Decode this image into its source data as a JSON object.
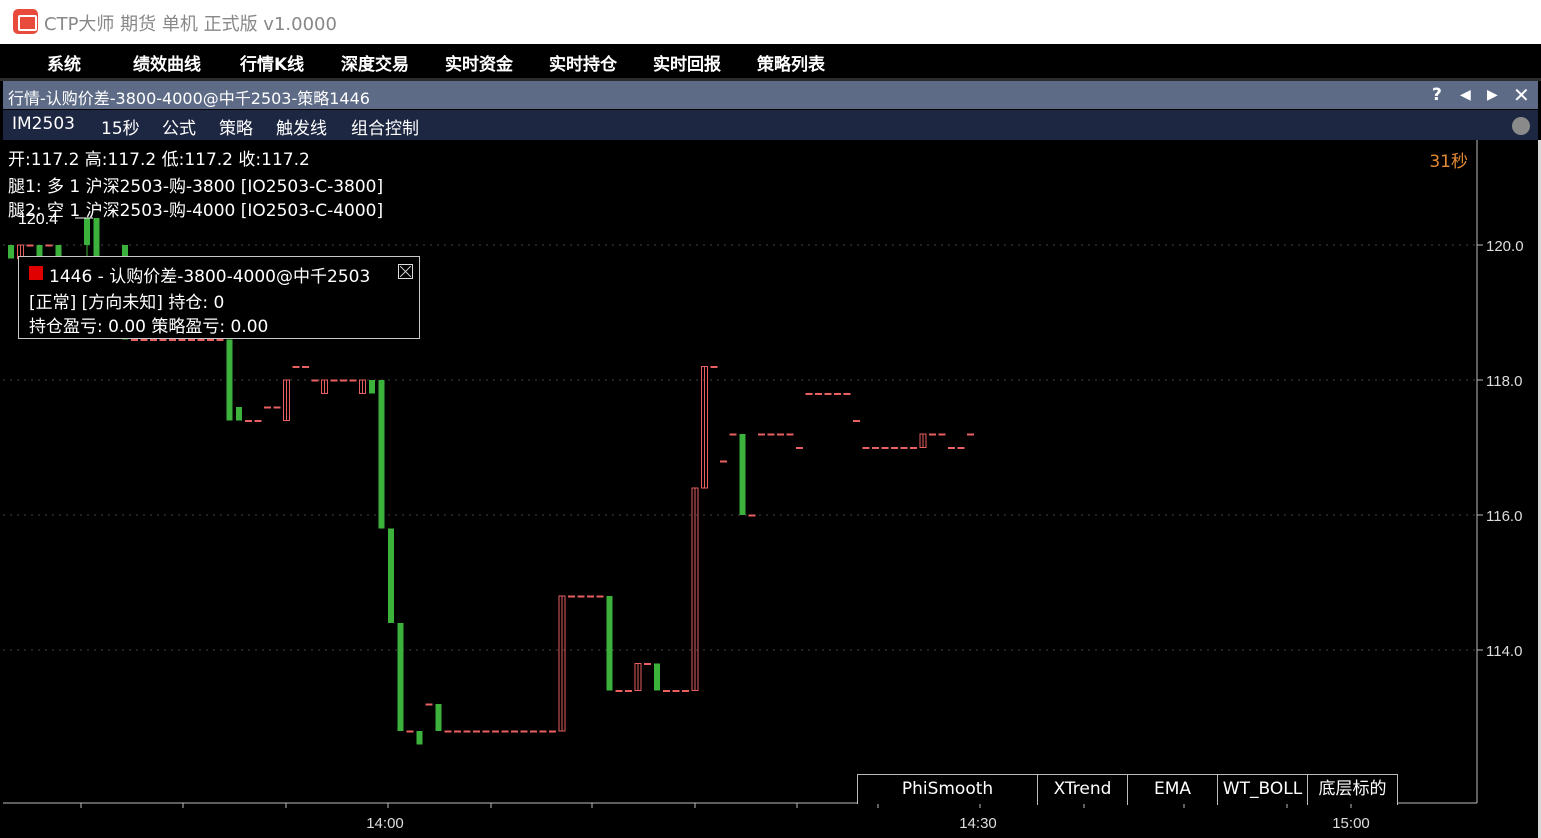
{
  "app": {
    "title": "CTP大师 期货 单机 正式版 v1.0000"
  },
  "menu": [
    "系统",
    "绩效曲线",
    "行情K线",
    "深度交易",
    "实时资金",
    "实时持仓",
    "实时回报",
    "策略列表"
  ],
  "window": {
    "title": "行情-认购价差-3800-4000@中千2503-策略1446",
    "buttons": [
      "?",
      "◀",
      "▶",
      "✕"
    ]
  },
  "toolbar": [
    "IM2503",
    "15秒",
    "公式",
    "策略",
    "触发线",
    "组合控制"
  ],
  "info": {
    "ohlc": "开:117.2 高:117.2 低:117.2 收:117.2",
    "leg1": "腿1: 多 1 沪深2503-购-3800 [IO2503-C-3800]",
    "leg2": "腿2: 空 1 沪深2503-购-4000 [IO2503-C-4000]",
    "timer": "31秒"
  },
  "popup": {
    "title": "1446 - 认购价差-3800-4000@中千2503",
    "line1": "[正常] [方向未知] 持仓: 0",
    "line2": "持仓盈亏: 0.00 策略盈亏: 0.00"
  },
  "indicators": [
    "PhiSmooth",
    "XTrend",
    "EMA",
    "WT_BOLL",
    "底层标的"
  ],
  "colors": {
    "up": "#e86060",
    "down": "#3cb23c",
    "accent": "#e38a34",
    "axis": "#bbbbbb"
  },
  "chart_data": {
    "type": "candlestick",
    "y_ticks": [
      120.0,
      118.0,
      116.0,
      114.0
    ],
    "x_ticks": [
      "14:00",
      "14:30",
      "15:00"
    ],
    "max_label": "120.4",
    "grid": true,
    "candles": [
      [
        120.0,
        120.0,
        119.8,
        119.8
      ],
      [
        119.8,
        120.0,
        119.8,
        120.0
      ],
      [
        120.0,
        120.0,
        120.0,
        120.0
      ],
      [
        120.0,
        120.0,
        119.8,
        119.8
      ],
      [
        120.0,
        120.0,
        120.0,
        120.0
      ],
      [
        120.0,
        120.0,
        119.6,
        119.6
      ],
      [
        119.6,
        119.6,
        119.6,
        119.6
      ],
      [
        119.6,
        119.6,
        119.6,
        119.6
      ],
      [
        120.4,
        120.4,
        119.6,
        120.0
      ],
      [
        120.4,
        120.4,
        119.8,
        119.8
      ],
      [
        119.8,
        119.8,
        119.6,
        119.6
      ],
      [
        119.6,
        119.6,
        119.6,
        119.6
      ],
      [
        120.0,
        120.0,
        118.6,
        118.6
      ],
      [
        118.6,
        118.6,
        118.6,
        118.6
      ],
      [
        118.6,
        118.6,
        118.6,
        118.6
      ],
      [
        118.6,
        118.6,
        118.6,
        118.6
      ],
      [
        118.6,
        118.6,
        118.6,
        118.6
      ],
      [
        118.6,
        118.6,
        118.6,
        118.6
      ],
      [
        118.6,
        118.6,
        118.6,
        118.6
      ],
      [
        118.6,
        118.6,
        118.6,
        118.6
      ],
      [
        118.6,
        118.6,
        118.6,
        118.6
      ],
      [
        118.6,
        118.6,
        118.6,
        118.6
      ],
      [
        118.6,
        118.6,
        118.6,
        118.6
      ],
      [
        118.6,
        118.6,
        117.4,
        117.4
      ],
      [
        117.6,
        117.6,
        117.4,
        117.4
      ],
      [
        117.4,
        117.4,
        117.4,
        117.4
      ],
      [
        117.4,
        117.4,
        117.4,
        117.4
      ],
      [
        117.6,
        117.6,
        117.6,
        117.6
      ],
      [
        117.6,
        117.6,
        117.6,
        117.6
      ],
      [
        117.4,
        118.0,
        117.4,
        118.0
      ],
      [
        118.2,
        118.2,
        118.2,
        118.2
      ],
      [
        118.2,
        118.2,
        118.2,
        118.2
      ],
      [
        118.0,
        118.0,
        118.0,
        118.0
      ],
      [
        117.8,
        118.0,
        117.8,
        118.0
      ],
      [
        118.0,
        118.0,
        118.0,
        118.0
      ],
      [
        118.0,
        118.0,
        118.0,
        118.0
      ],
      [
        118.0,
        118.0,
        118.0,
        118.0
      ],
      [
        117.8,
        118.0,
        117.8,
        118.0
      ],
      [
        118.0,
        118.0,
        117.8,
        117.8
      ],
      [
        118.0,
        118.0,
        115.8,
        115.8
      ],
      [
        115.8,
        115.8,
        114.4,
        114.4
      ],
      [
        114.4,
        114.4,
        112.8,
        112.8
      ],
      [
        112.8,
        112.8,
        112.8,
        112.8
      ],
      [
        112.8,
        112.8,
        112.6,
        112.6
      ],
      [
        113.2,
        113.2,
        113.2,
        113.2
      ],
      [
        113.2,
        113.2,
        112.8,
        112.8
      ],
      [
        112.8,
        112.8,
        112.8,
        112.8
      ],
      [
        112.8,
        112.8,
        112.8,
        112.8
      ],
      [
        112.8,
        112.8,
        112.8,
        112.8
      ],
      [
        112.8,
        112.8,
        112.8,
        112.8
      ],
      [
        112.8,
        112.8,
        112.8,
        112.8
      ],
      [
        112.8,
        112.8,
        112.8,
        112.8
      ],
      [
        112.8,
        112.8,
        112.8,
        112.8
      ],
      [
        112.8,
        112.8,
        112.8,
        112.8
      ],
      [
        112.8,
        112.8,
        112.8,
        112.8
      ],
      [
        112.8,
        112.8,
        112.8,
        112.8
      ],
      [
        112.8,
        112.8,
        112.8,
        112.8
      ],
      [
        112.8,
        112.8,
        112.8,
        112.8
      ],
      [
        112.8,
        114.8,
        112.8,
        114.8
      ],
      [
        114.8,
        114.8,
        114.8,
        114.8
      ],
      [
        114.8,
        114.8,
        114.8,
        114.8
      ],
      [
        114.8,
        114.8,
        114.8,
        114.8
      ],
      [
        114.8,
        114.8,
        114.8,
        114.8
      ],
      [
        114.8,
        114.8,
        113.4,
        113.4
      ],
      [
        113.4,
        113.4,
        113.4,
        113.4
      ],
      [
        113.4,
        113.4,
        113.4,
        113.4
      ],
      [
        113.4,
        113.8,
        113.4,
        113.8
      ],
      [
        113.8,
        113.8,
        113.8,
        113.8
      ],
      [
        113.8,
        113.8,
        113.4,
        113.4
      ],
      [
        113.4,
        113.4,
        113.4,
        113.4
      ],
      [
        113.4,
        113.4,
        113.4,
        113.4
      ],
      [
        113.4,
        113.4,
        113.4,
        113.4
      ],
      [
        113.4,
        116.4,
        113.4,
        116.4
      ],
      [
        116.4,
        118.2,
        116.4,
        118.2
      ],
      [
        118.2,
        118.2,
        118.2,
        118.2
      ],
      [
        116.8,
        116.8,
        116.8,
        116.8
      ],
      [
        117.2,
        117.2,
        117.2,
        117.2
      ],
      [
        117.2,
        117.2,
        116.0,
        116.0
      ],
      [
        116.0,
        116.0,
        116.0,
        116.0
      ],
      [
        117.2,
        117.2,
        117.2,
        117.2
      ],
      [
        117.2,
        117.2,
        117.2,
        117.2
      ],
      [
        117.2,
        117.2,
        117.2,
        117.2
      ],
      [
        117.2,
        117.2,
        117.2,
        117.2
      ],
      [
        117.0,
        117.0,
        117.0,
        117.0
      ],
      [
        117.8,
        117.8,
        117.8,
        117.8
      ],
      [
        117.8,
        117.8,
        117.8,
        117.8
      ],
      [
        117.8,
        117.8,
        117.8,
        117.8
      ],
      [
        117.8,
        117.8,
        117.8,
        117.8
      ],
      [
        117.8,
        117.8,
        117.8,
        117.8
      ],
      [
        117.4,
        117.4,
        117.4,
        117.4
      ],
      [
        117.0,
        117.0,
        117.0,
        117.0
      ],
      [
        117.0,
        117.0,
        117.0,
        117.0
      ],
      [
        117.0,
        117.0,
        117.0,
        117.0
      ],
      [
        117.0,
        117.0,
        117.0,
        117.0
      ],
      [
        117.0,
        117.0,
        117.0,
        117.0
      ],
      [
        117.0,
        117.0,
        117.0,
        117.0
      ],
      [
        117.0,
        117.2,
        117.0,
        117.2
      ],
      [
        117.2,
        117.2,
        117.2,
        117.2
      ],
      [
        117.2,
        117.2,
        117.2,
        117.2
      ],
      [
        117.0,
        117.0,
        117.0,
        117.0
      ],
      [
        117.0,
        117.0,
        117.0,
        117.0
      ],
      [
        117.2,
        117.2,
        117.2,
        117.2
      ]
    ]
  }
}
